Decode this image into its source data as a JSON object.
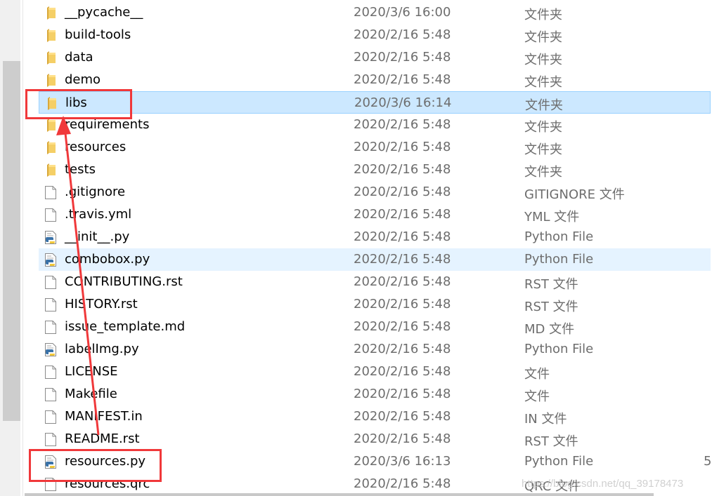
{
  "files": [
    {
      "name": "__pycache__",
      "date": "2020/3/6 16:00",
      "type": "文件夹",
      "icon": "folder"
    },
    {
      "name": "build-tools",
      "date": "2020/2/16 5:48",
      "type": "文件夹",
      "icon": "folder"
    },
    {
      "name": "data",
      "date": "2020/2/16 5:48",
      "type": "文件夹",
      "icon": "folder"
    },
    {
      "name": "demo",
      "date": "2020/2/16 5:48",
      "type": "文件夹",
      "icon": "folder"
    },
    {
      "name": "libs",
      "date": "2020/3/6 16:14",
      "type": "文件夹",
      "icon": "folder",
      "state": "selected"
    },
    {
      "name": "requirements",
      "date": "2020/2/16 5:48",
      "type": "文件夹",
      "icon": "folder"
    },
    {
      "name": "resources",
      "date": "2020/2/16 5:48",
      "type": "文件夹",
      "icon": "folder"
    },
    {
      "name": "tests",
      "date": "2020/2/16 5:48",
      "type": "文件夹",
      "icon": "folder"
    },
    {
      "name": ".gitignore",
      "date": "2020/2/16 5:48",
      "type": "GITIGNORE 文件",
      "icon": "file"
    },
    {
      "name": ".travis.yml",
      "date": "2020/2/16 5:48",
      "type": "YML 文件",
      "icon": "file"
    },
    {
      "name": "__init__.py",
      "date": "2020/2/16 5:48",
      "type": "Python File",
      "icon": "python"
    },
    {
      "name": "combobox.py",
      "date": "2020/2/16 5:48",
      "type": "Python File",
      "icon": "python",
      "state": "hover"
    },
    {
      "name": "CONTRIBUTING.rst",
      "date": "2020/2/16 5:48",
      "type": "RST 文件",
      "icon": "file"
    },
    {
      "name": "HISTORY.rst",
      "date": "2020/2/16 5:48",
      "type": "RST 文件",
      "icon": "file"
    },
    {
      "name": "issue_template.md",
      "date": "2020/2/16 5:48",
      "type": "MD 文件",
      "icon": "file"
    },
    {
      "name": "labelImg.py",
      "date": "2020/2/16 5:48",
      "type": "Python File",
      "icon": "python"
    },
    {
      "name": "LICENSE",
      "date": "2020/2/16 5:48",
      "type": "文件",
      "icon": "file"
    },
    {
      "name": "Makefile",
      "date": "2020/2/16 5:48",
      "type": "文件",
      "icon": "file"
    },
    {
      "name": "MANIFEST.in",
      "date": "2020/2/16 5:48",
      "type": "IN 文件",
      "icon": "file"
    },
    {
      "name": "README.rst",
      "date": "2020/2/16 5:48",
      "type": "RST 文件",
      "icon": "file"
    },
    {
      "name": "resources.py",
      "date": "2020/3/6 16:13",
      "type": "Python File",
      "icon": "python",
      "size": "5"
    },
    {
      "name": "resources.qrc",
      "date": "2020/2/16 5:48",
      "type": "QRC 文件",
      "icon": "file"
    }
  ],
  "watermark": "https://blog.csdn.net/qq_39178473",
  "colors": {
    "annotation": "#f0383a",
    "selected": "#cce8ff",
    "hover": "#e5f3ff"
  }
}
